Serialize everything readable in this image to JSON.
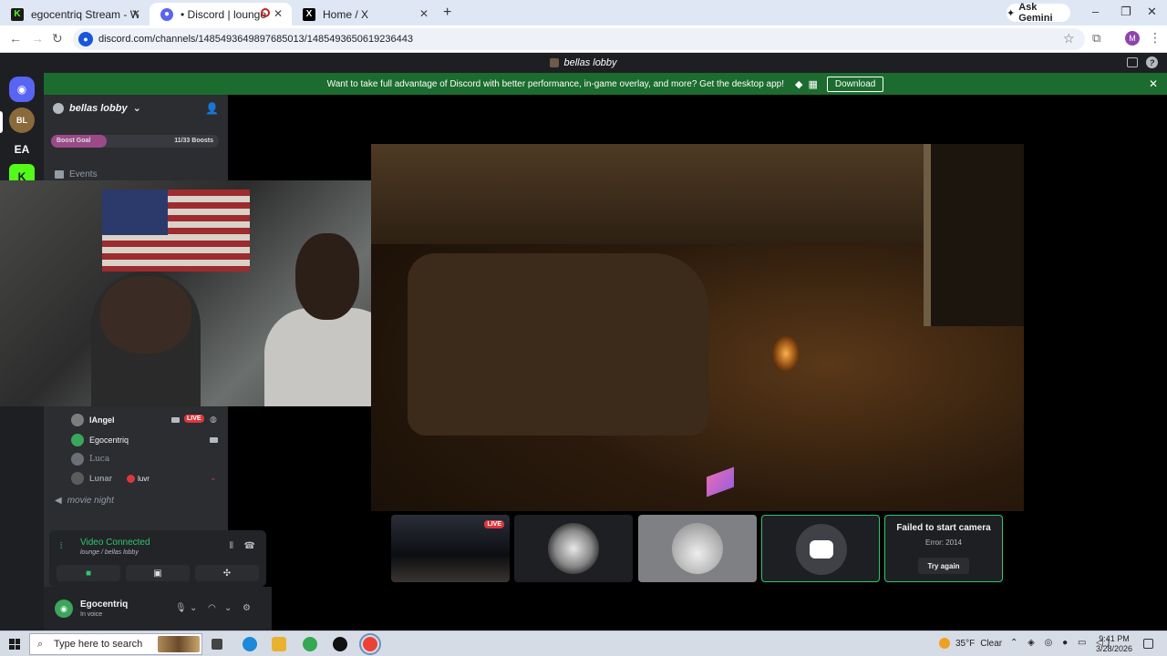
{
  "browser": {
    "tabs": [
      {
        "title": "egocentriq Stream - Watch Live",
        "favicon_color": "#53fc18"
      },
      {
        "title": "• Discord | lounge | bellas lo…",
        "favicon_color": "#5865f2"
      },
      {
        "title": "Home / X",
        "favicon_color": "#000000"
      }
    ],
    "ask_gemini": "Ask Gemini",
    "url": "discord.com/channels/1485493649897685013/1485493650619236443"
  },
  "discord": {
    "window_title": "bellas lobby",
    "promo": {
      "text": "Want to take full advantage of Discord with better performance, in-game overlay, and more? Get the desktop app!",
      "download": "Download"
    },
    "guilds": [
      {
        "label": "BL",
        "color": "#8a6a3a"
      },
      {
        "label": "EA",
        "color": "#1e1f22"
      },
      {
        "label": "K",
        "color": "#53fc18"
      }
    ],
    "server": {
      "name": "bellas lobby",
      "boost_label": "Boost Goal",
      "boost_count": "11/33 Boosts",
      "boost_progress": 0.33,
      "events": "Events"
    },
    "voice_members": [
      {
        "name": "lAngel",
        "live": "LIVE",
        "color": "#7d7d7d"
      },
      {
        "name": "Egocentriq",
        "live": "",
        "color": "#3ba55d"
      },
      {
        "name": "Luca",
        "live": "",
        "color": "#6d6f78"
      },
      {
        "name": "Lunar",
        "live": "",
        "color": "#5c5c5c",
        "tag": "luvr"
      }
    ],
    "movie_channel": "movie night",
    "voice_panel": {
      "status": "Video Connected",
      "location": "lounge / bellas lobby"
    },
    "user": {
      "name": "Egocentriq",
      "status": "In voice"
    },
    "tiles": {
      "live_badge": "LIVE",
      "camera_error_title": "Failed to start camera",
      "camera_error_code": "Error: 2014",
      "try_again": "Try again"
    }
  },
  "taskbar": {
    "search_placeholder": "Type here to search",
    "temperature": "35°F",
    "condition": "Clear",
    "time": "9:41 PM",
    "date": "3/28/2026"
  }
}
